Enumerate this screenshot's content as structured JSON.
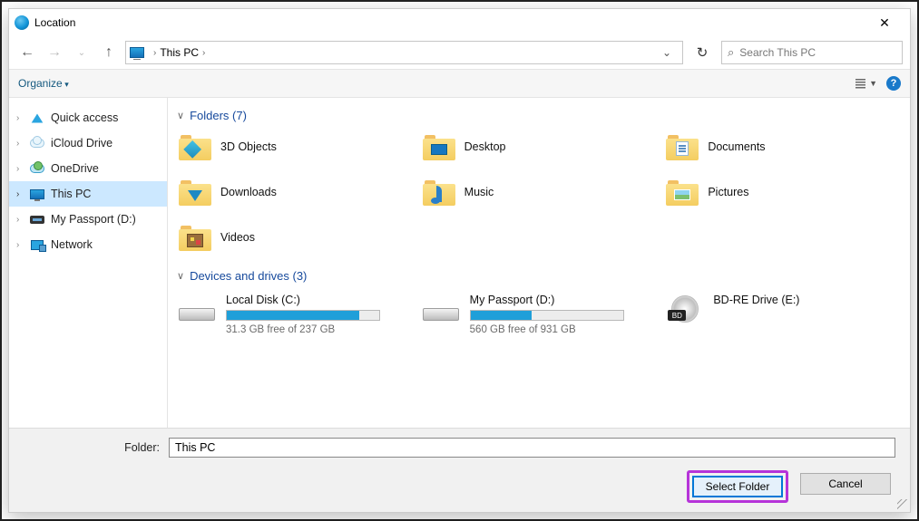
{
  "title": "Location",
  "breadcrumb": {
    "root_label": "This PC"
  },
  "search": {
    "placeholder": "Search This PC"
  },
  "toolbar": {
    "organize": "Organize"
  },
  "tree": {
    "items": [
      {
        "label": "Quick access",
        "icon": "star"
      },
      {
        "label": "iCloud Drive",
        "icon": "cloud"
      },
      {
        "label": "OneDrive",
        "icon": "onedrive"
      },
      {
        "label": "This PC",
        "icon": "pc",
        "selected": true
      },
      {
        "label": "My Passport (D:)",
        "icon": "ext"
      },
      {
        "label": "Network",
        "icon": "net"
      }
    ]
  },
  "sections": {
    "folders": {
      "header": "Folders (7)",
      "items": [
        {
          "label": "3D Objects",
          "ov": "cube"
        },
        {
          "label": "Desktop",
          "ov": "desk"
        },
        {
          "label": "Documents",
          "ov": "doc"
        },
        {
          "label": "Downloads",
          "ov": "down"
        },
        {
          "label": "Music",
          "ov": "music"
        },
        {
          "label": "Pictures",
          "ov": "pic"
        },
        {
          "label": "Videos",
          "ov": "vid"
        }
      ]
    },
    "drives": {
      "header": "Devices and drives (3)",
      "items": [
        {
          "label": "Local Disk (C:)",
          "sub": "31.3 GB free of 237 GB",
          "fill": 87,
          "type": "hdd",
          "win": true
        },
        {
          "label": "My Passport (D:)",
          "sub": "560 GB free of 931 GB",
          "fill": 40,
          "type": "hdd"
        },
        {
          "label": "BD-RE Drive (E:)",
          "type": "optical"
        }
      ]
    }
  },
  "folder_field": {
    "label": "Folder:",
    "value": "This PC"
  },
  "buttons": {
    "select": "Select Folder",
    "cancel": "Cancel"
  }
}
